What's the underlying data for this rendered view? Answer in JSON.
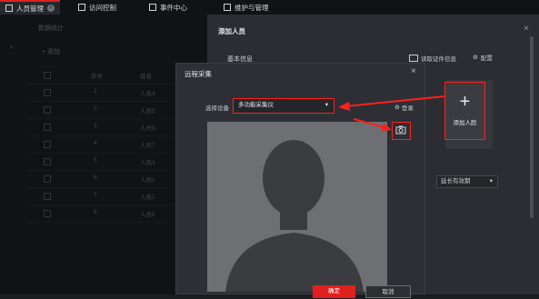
{
  "tabs": [
    {
      "label": "人员管理",
      "active": true
    },
    {
      "label": "访问控制",
      "active": false
    },
    {
      "label": "事件中心",
      "active": false
    },
    {
      "label": "维护与管理",
      "active": false
    }
  ],
  "main": {
    "stats_label": "数据统计",
    "add_label": "添加",
    "headers": [
      "序号",
      "姓名"
    ],
    "rows": [
      {
        "no": "1",
        "name": "人员4"
      },
      {
        "no": "2",
        "name": "人员5"
      },
      {
        "no": "3",
        "name": "人员6"
      },
      {
        "no": "4",
        "name": "人员7"
      },
      {
        "no": "5",
        "name": "人员3"
      },
      {
        "no": "6",
        "name": "人员2"
      },
      {
        "no": "7",
        "name": "人员1"
      },
      {
        "no": "8",
        "name": "人员8"
      }
    ]
  },
  "right_panel": {
    "title": "添加人员",
    "section": "基本信息",
    "read_id_label": "读取证件信息",
    "config_label": "配置",
    "add_face_label": "添加人脸",
    "validity_select": "延长有效期"
  },
  "dialog": {
    "title": "远程采集",
    "device_label": "选择设备",
    "device_value": "多功能采集仪",
    "login_label": "登录",
    "ok_label": "确定",
    "cancel_label": "取消"
  },
  "colors": {
    "accent_red": "#e02020",
    "highlight": "#ff2020",
    "bg": "#1b1d21"
  }
}
